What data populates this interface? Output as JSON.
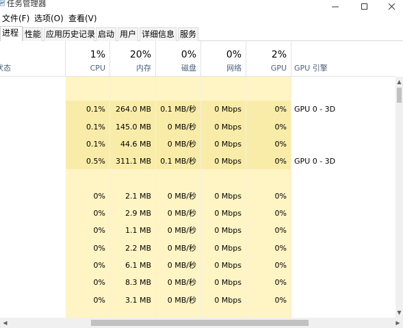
{
  "window": {
    "title": "任务管理器",
    "controls": {
      "minimize": "—",
      "maximize": "□",
      "close": "✕"
    }
  },
  "menu": [
    "文件(F)",
    "选项(O)",
    "查看(V)"
  ],
  "tabs": [
    "进程",
    "性能",
    "应用历史记录",
    "启动",
    "用户",
    "详细信息",
    "服务"
  ],
  "active_tab": 0,
  "header": {
    "status_label": "状态",
    "columns": [
      {
        "pct": "1%",
        "label": "CPU"
      },
      {
        "pct": "20%",
        "label": "内存"
      },
      {
        "pct": "0%",
        "label": "磁盘"
      },
      {
        "pct": "0%",
        "label": "网络"
      },
      {
        "pct": "2%",
        "label": "GPU"
      }
    ],
    "gpu_engine_label": "GPU 引擎"
  },
  "rows": [
    {
      "cpu": "",
      "mem": "",
      "disk": "",
      "net": "",
      "gpu": "",
      "eng": ""
    },
    {
      "cpu": "0.1%",
      "mem": "264.0 MB",
      "disk": "0.1 MB/秒",
      "net": "0 Mbps",
      "gpu": "0%",
      "eng": "GPU 0 - 3D"
    },
    {
      "cpu": "0.1%",
      "mem": "145.0 MB",
      "disk": "0 MB/秒",
      "net": "0 Mbps",
      "gpu": "0%",
      "eng": ""
    },
    {
      "cpu": "0.1%",
      "mem": "44.6 MB",
      "disk": "0 MB/秒",
      "net": "0 Mbps",
      "gpu": "0%",
      "eng": ""
    },
    {
      "cpu": "0.5%",
      "mem": "311.1 MB",
      "disk": "0.1 MB/秒",
      "net": "0 Mbps",
      "gpu": "0%",
      "eng": "GPU 0 - 3D"
    },
    {
      "cpu": "",
      "mem": "",
      "disk": "",
      "net": "",
      "gpu": "",
      "eng": ""
    },
    {
      "cpu": "0%",
      "mem": "2.1 MB",
      "disk": "0 MB/秒",
      "net": "0 Mbps",
      "gpu": "0%",
      "eng": ""
    },
    {
      "cpu": "0%",
      "mem": "2.9 MB",
      "disk": "0 MB/秒",
      "net": "0 Mbps",
      "gpu": "0%",
      "eng": ""
    },
    {
      "cpu": "0%",
      "mem": "1.1 MB",
      "disk": "0 MB/秒",
      "net": "0 Mbps",
      "gpu": "0%",
      "eng": ""
    },
    {
      "cpu": "0%",
      "mem": "2.2 MB",
      "disk": "0 MB/秒",
      "net": "0 Mbps",
      "gpu": "0%",
      "eng": ""
    },
    {
      "cpu": "0%",
      "mem": "6.1 MB",
      "disk": "0 MB/秒",
      "net": "0 Mbps",
      "gpu": "0%",
      "eng": ""
    },
    {
      "cpu": "0%",
      "mem": "8.3 MB",
      "disk": "0 MB/秒",
      "net": "0 Mbps",
      "gpu": "0%",
      "eng": ""
    },
    {
      "cpu": "0%",
      "mem": "3.1 MB",
      "disk": "0 MB/秒",
      "net": "0 Mbps",
      "gpu": "0%",
      "eng": ""
    },
    {
      "cpu": "",
      "mem": "",
      "disk": "",
      "net": "",
      "gpu": "",
      "eng": ""
    }
  ],
  "colors": {
    "heat_light": "#fff4c4",
    "heat_medium": "#f9eca8",
    "header_label": "#4c607a"
  },
  "icons": {
    "app": "task-manager-icon",
    "scroll_up": "▲",
    "scroll_down": "▼",
    "scroll_left": "◀",
    "scroll_right": "▶"
  }
}
